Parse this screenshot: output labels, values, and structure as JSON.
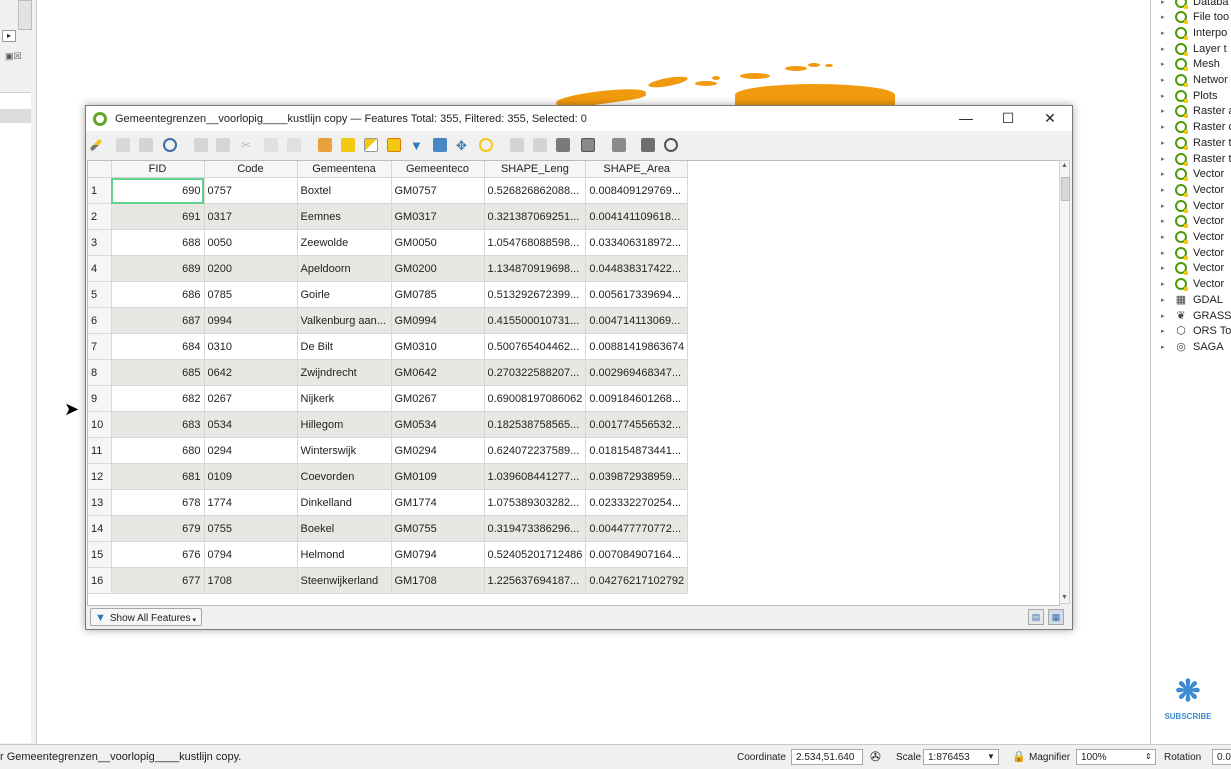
{
  "window": {
    "title": "Gemeentegrenzen__voorlopig____kustlijn copy — Features Total: 355, Filtered: 355, Selected: 0",
    "minimize": "—",
    "maximize": "☐",
    "close": "✕"
  },
  "table": {
    "columns": [
      "FID",
      "Code",
      "Gemeentena",
      "Gemeenteco",
      "SHAPE_Leng",
      "SHAPE_Area"
    ],
    "rows": [
      [
        "1",
        "690",
        "0757",
        "Boxtel",
        "GM0757",
        "0.526826862088...",
        "0.008409129769..."
      ],
      [
        "2",
        "691",
        "0317",
        "Eemnes",
        "GM0317",
        "0.321387069251...",
        "0.004141109618..."
      ],
      [
        "3",
        "688",
        "0050",
        "Zeewolde",
        "GM0050",
        "1.054768088598...",
        "0.033406318972..."
      ],
      [
        "4",
        "689",
        "0200",
        "Apeldoorn",
        "GM0200",
        "1.134870919698...",
        "0.044838317422..."
      ],
      [
        "5",
        "686",
        "0785",
        "Goirle",
        "GM0785",
        "0.513292672399...",
        "0.005617339694..."
      ],
      [
        "6",
        "687",
        "0994",
        "Valkenburg aan...",
        "GM0994",
        "0.415500010731...",
        "0.004714113069..."
      ],
      [
        "7",
        "684",
        "0310",
        "De Bilt",
        "GM0310",
        "0.500765404462...",
        "0.00881419863674"
      ],
      [
        "8",
        "685",
        "0642",
        "Zwijndrecht",
        "GM0642",
        "0.270322588207...",
        "0.002969468347..."
      ],
      [
        "9",
        "682",
        "0267",
        "Nijkerk",
        "GM0267",
        "0.69008197086062",
        "0.009184601268..."
      ],
      [
        "10",
        "683",
        "0534",
        "Hillegom",
        "GM0534",
        "0.182538758565...",
        "0.001774556532..."
      ],
      [
        "11",
        "680",
        "0294",
        "Winterswijk",
        "GM0294",
        "0.624072237589...",
        "0.018154873441..."
      ],
      [
        "12",
        "681",
        "0109",
        "Coevorden",
        "GM0109",
        "1.039608441277...",
        "0.039872938959..."
      ],
      [
        "13",
        "678",
        "1774",
        "Dinkelland",
        "GM1774",
        "1.075389303282...",
        "0.023332270254..."
      ],
      [
        "14",
        "679",
        "0755",
        "Boekel",
        "GM0755",
        "0.319473386296...",
        "0.004477770772..."
      ],
      [
        "15",
        "676",
        "0794",
        "Helmond",
        "GM0794",
        "0.52405201712486",
        "0.007084907164..."
      ],
      [
        "16",
        "677",
        "1708",
        "Steenwijkerland",
        "GM1708",
        "1.225637694187...",
        "0.04276217102792"
      ]
    ]
  },
  "bottom": {
    "show_all": "Show All Features"
  },
  "toolbox": {
    "items": [
      {
        "label": "Databa",
        "icon": "qgis-icon"
      },
      {
        "label": "File too",
        "icon": "qgis-icon"
      },
      {
        "label": "Interpo",
        "icon": "qgis-icon"
      },
      {
        "label": "Layer t",
        "icon": "qgis-icon"
      },
      {
        "label": "Mesh",
        "icon": "qgis-icon"
      },
      {
        "label": "Networ",
        "icon": "qgis-icon"
      },
      {
        "label": "Plots",
        "icon": "qgis-icon"
      },
      {
        "label": "Raster a",
        "icon": "qgis-icon"
      },
      {
        "label": "Raster c",
        "icon": "qgis-icon"
      },
      {
        "label": "Raster t",
        "icon": "qgis-icon"
      },
      {
        "label": "Raster t",
        "icon": "qgis-icon"
      },
      {
        "label": "Vector",
        "icon": "qgis-icon"
      },
      {
        "label": "Vector",
        "icon": "qgis-icon"
      },
      {
        "label": "Vector",
        "icon": "qgis-icon"
      },
      {
        "label": "Vector",
        "icon": "qgis-icon"
      },
      {
        "label": "Vector",
        "icon": "qgis-icon"
      },
      {
        "label": "Vector",
        "icon": "qgis-icon"
      },
      {
        "label": "Vector",
        "icon": "qgis-icon"
      },
      {
        "label": "Vector",
        "icon": "qgis-icon"
      },
      {
        "label": "GDAL",
        "icon": "gdal-icon"
      },
      {
        "label": "GRASS",
        "icon": "grass-icon"
      },
      {
        "label": "ORS To",
        "icon": "ors-icon"
      },
      {
        "label": "SAGA",
        "icon": "saga-icon"
      }
    ],
    "subscribe": "SUBSCRIBE"
  },
  "status": {
    "message": "r Gemeentegrenzen__voorlopig____kustlijn copy.",
    "coordinate_label": "Coordinate",
    "coordinate_value": "2.534,51.640",
    "scale_label": "Scale",
    "scale_value": "1:876453",
    "magnifier_label": "Magnifier",
    "magnifier_value": "100%",
    "rotation_label": "Rotation",
    "rotation_value": "0.0"
  },
  "colors": {
    "map_fill": "#f29a0d",
    "selection_outline": "#5fd38d",
    "qgis_green": "#62a62a"
  }
}
